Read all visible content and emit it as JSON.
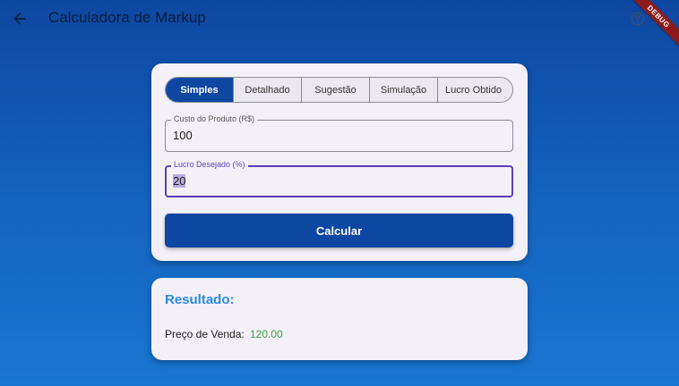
{
  "appbar": {
    "title": "Calculadora de Markup",
    "back_icon": "arrow-left-icon",
    "help_icon": "help-circle-icon"
  },
  "debug_banner": "DEBUG",
  "tabs": [
    {
      "label": "Simples",
      "selected": true
    },
    {
      "label": "Detalhado",
      "selected": false
    },
    {
      "label": "Sugestão",
      "selected": false
    },
    {
      "label": "Simulação",
      "selected": false
    },
    {
      "label": "Lucro Obtido",
      "selected": false
    }
  ],
  "form": {
    "cost_label": "Custo do Produto (R$)",
    "cost_value": "100",
    "profit_label": "Lucro Desejado (%)",
    "profit_value": "20",
    "calculate_label": "Calcular"
  },
  "result": {
    "title": "Resultado:",
    "sale_price_label": "Preço de Venda:",
    "sale_price_value": "120.00"
  },
  "colors": {
    "primary": "#0d47a1",
    "accent_title": "#2a8be0",
    "value_green": "#43a047",
    "focus": "#5b3fb8"
  }
}
